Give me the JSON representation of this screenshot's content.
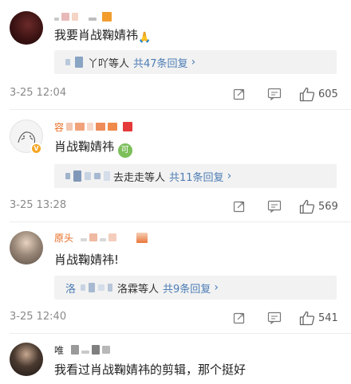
{
  "comments": [
    {
      "text": "我要肖战鞠婧祎",
      "emoji": "🙏",
      "reply_prefix": "丫吖等人",
      "reply_count": "共47条回复",
      "time": "3-25 12:04",
      "likes": "605"
    },
    {
      "name_prefix": "容",
      "text": "肖战鞠婧祎",
      "emoji_badge": "可",
      "reply_prefix": "去走走等人",
      "reply_count": "共11条回复",
      "time": "3-25 13:28",
      "likes": "569"
    },
    {
      "name_prefix": "原头",
      "text": "肖战鞠婧祎!",
      "reply_first": "洛",
      "reply_prefix": "洛霖等人",
      "reply_count": "共9条回复",
      "time": "3-25 12:40",
      "likes": "541"
    },
    {
      "name_prefix": "唯",
      "text": "我看过肖战鞠婧祎的剪辑，那个挺好"
    }
  ],
  "icons": [
    "share-icon",
    "comment-icon",
    "like-icon",
    "chevron-right-icon",
    "verified-badge-icon"
  ],
  "colors": {
    "link": "#4d7db5",
    "name_orange": "#e86b1f",
    "meta_gray": "#8a8a8a",
    "reply_bg": "#f2f2f2"
  }
}
